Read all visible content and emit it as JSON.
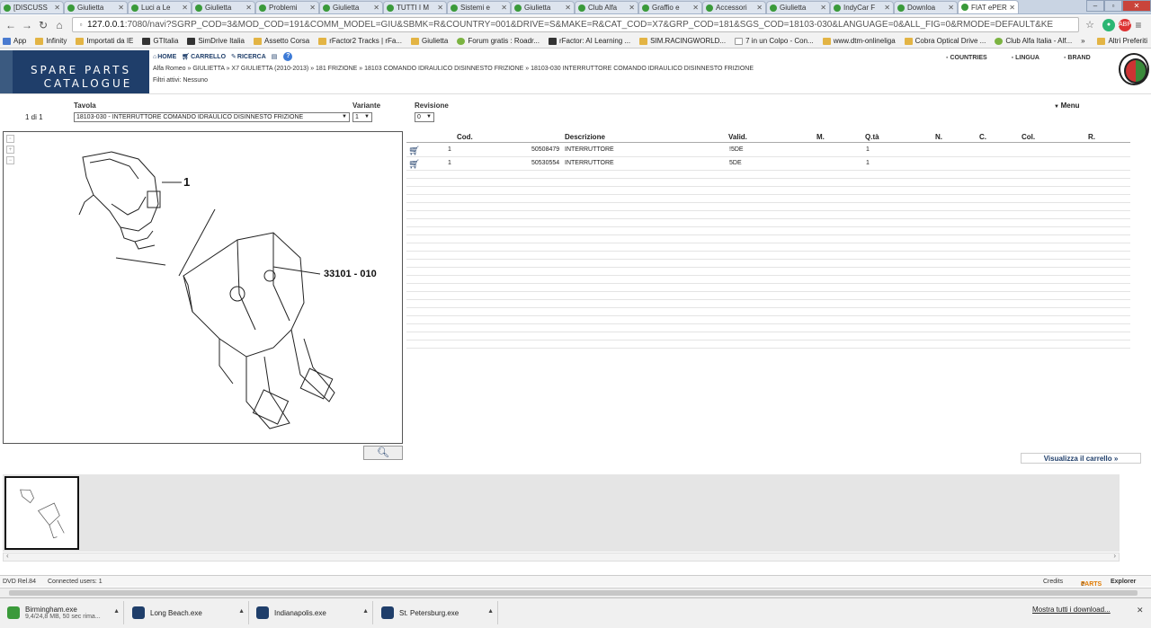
{
  "tabs": [
    {
      "label": "[DISCUSS"
    },
    {
      "label": "Giulietta"
    },
    {
      "label": "Luci a Le"
    },
    {
      "label": "Giulietta"
    },
    {
      "label": "Problemi"
    },
    {
      "label": "Giulietta"
    },
    {
      "label": "TUTTI I M"
    },
    {
      "label": "Sistemi e"
    },
    {
      "label": "Giulietta"
    },
    {
      "label": "Club Alfa"
    },
    {
      "label": "Graffio e"
    },
    {
      "label": "Accessori"
    },
    {
      "label": "Giulietta"
    },
    {
      "label": "IndyCar F"
    },
    {
      "label": "Downloa"
    },
    {
      "label": "FIAT ePER"
    }
  ],
  "url": {
    "host": "127.0.0.1",
    "path": ":7080/navi?SGRP_COD=3&MOD_COD=191&COMM_MODEL=GIU&SBMK=R&COUNTRY=001&DRIVE=S&MAKE=R&CAT_COD=X7&GRP_COD=181&SGS_COD=18103-030&LANGUAGE=0&ALL_FIG=0&RMODE=DEFAULT&KE"
  },
  "bookmarks": [
    {
      "label": "App"
    },
    {
      "label": "Infinity"
    },
    {
      "label": "Importati da IE"
    },
    {
      "label": "GTItalia"
    },
    {
      "label": "SimDrive Italia"
    },
    {
      "label": "Assetto Corsa"
    },
    {
      "label": "rFactor2 Tracks | rFa..."
    },
    {
      "label": "Giulietta"
    },
    {
      "label": "Forum gratis : Roadr..."
    },
    {
      "label": "rFactor: AI Learning ..."
    },
    {
      "label": "SIM.RACINGWORLD..."
    },
    {
      "label": "7 in un Colpo - Con..."
    },
    {
      "label": "www.dtm-onlineliga"
    },
    {
      "label": "Cobra Optical Drive ..."
    },
    {
      "label": "Club Alfa Italia - Alf..."
    },
    {
      "label": "»"
    }
  ],
  "bookmarks_other": "Altri Preferiti",
  "logo": {
    "line1": "SPARE PARTS",
    "line2": "CATALOGUE"
  },
  "topnav": {
    "home": "HOME",
    "cart": "CARRELLO",
    "search": "RICERCA",
    "help": "?"
  },
  "rightnav": {
    "countries": "COUNTRIES",
    "lingua": "LINGUA",
    "brand": "BRAND"
  },
  "breadcrumb": "Alfa Romeo » GIULIETTA » X7 GIULIETTA (2010-2013) » 181 FRIZIONE » 18103 COMANDO IDRAULICO DISINNESTO FRIZIONE » 18103-030 INTERRUTTORE COMANDO IDRAULICO DISINNESTO FRIZIONE",
  "filtri": "Filtri attivi: Nessuno",
  "selection": {
    "count": "1 di 1",
    "tavola_label": "Tavola",
    "tavola_value": "18103-030 - INTERRUTTORE COMANDO IDRAULICO DISINNESTO FRIZIONE",
    "variante_label": "Variante",
    "variante_value": "1",
    "revisione_label": "Revisione",
    "revisione_value": "0",
    "menu": "Menu"
  },
  "drawing": {
    "callout1": "1",
    "callout2": "33101 - 010"
  },
  "table": {
    "headers": {
      "cod": "Cod.",
      "descrizione": "Descrizione",
      "valid": "Valid.",
      "m": "M.",
      "qta": "Q.tà",
      "n": "N.",
      "c": "C.",
      "col": "Col.",
      "r": "R."
    },
    "rows": [
      {
        "ref": "1",
        "code": "50508479",
        "desc": "INTERRUTTORE",
        "valid": "!5DE",
        "qty": "1"
      },
      {
        "ref": "1",
        "code": "50530554",
        "desc": "INTERRUTTORE",
        "valid": "5DE",
        "qty": "1"
      }
    ]
  },
  "visualizza": "Visualizza il carrello »",
  "status": {
    "dvd": "DVD Rel.84",
    "users": "Connected users: 1",
    "credits": "Credits",
    "eparts_brand": "PARTS",
    "explorer": "Explorer"
  },
  "downloads": [
    {
      "name": "Birmingham.exe",
      "sub": "9,4/24,8 MB, 50 sec rima..."
    },
    {
      "name": "Long Beach.exe",
      "sub": ""
    },
    {
      "name": "Indianapolis.exe",
      "sub": ""
    },
    {
      "name": "St. Petersburg.exe",
      "sub": ""
    }
  ],
  "downloads_showall": "Mostra tutti i download...",
  "colors": {
    "brand_blue": "#1f3e6a",
    "tab_favicon": "#3a9a3a"
  }
}
